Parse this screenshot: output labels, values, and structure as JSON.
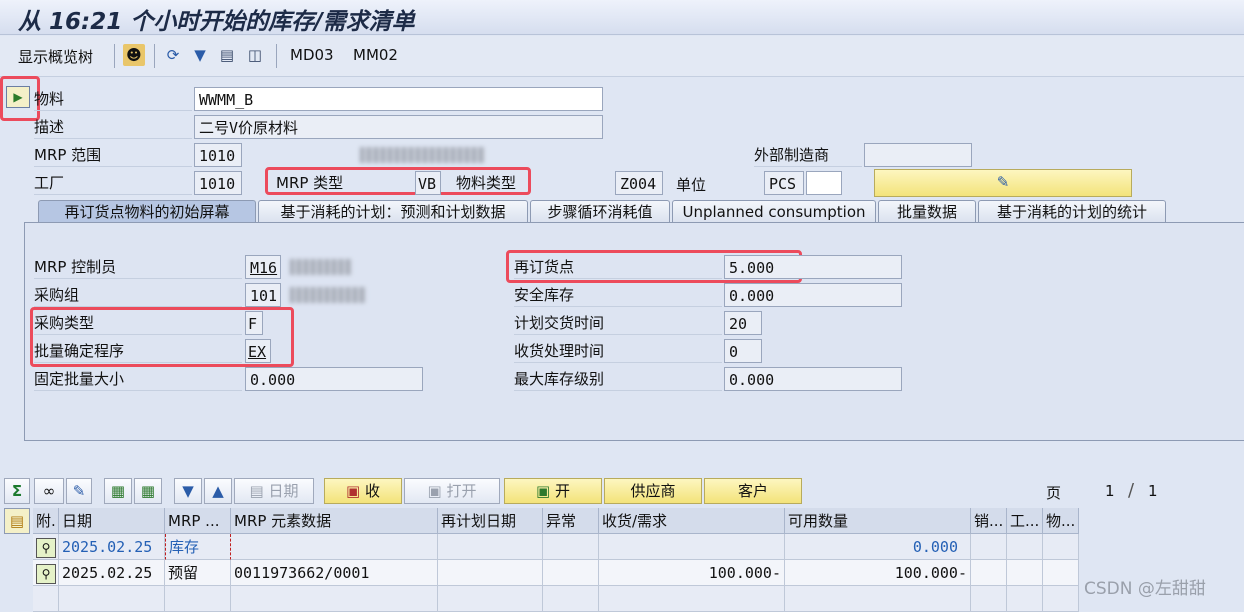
{
  "window": {
    "title": "从 16:21 个小时开始的库存/需求清单"
  },
  "app_toolbar": {
    "show_overview_tree": "显示概览树",
    "md03": "MD03",
    "mm02": "MM02"
  },
  "header": {
    "material_label": "物料",
    "material_value": "WWMM_B",
    "description_label": "描述",
    "description_value": "二号V价原材料",
    "mrp_area_label": "MRP 范围",
    "mrp_area_value": "1010",
    "ext_manufacturer_label": "外部制造商",
    "ext_manufacturer_value": "",
    "plant_label": "工厂",
    "plant_value": "1010",
    "mrp_type_label": "MRP 类型",
    "mrp_type_value": "VB",
    "material_type_label": "物料类型",
    "material_type_value": "Z004",
    "unit_label": "单位",
    "unit_value": "PCS"
  },
  "tabs": [
    "再订货点物料的初始屏幕",
    "基于消耗的计划：预测和计划数据",
    "步骤循环消耗值",
    "Unplanned consumption",
    "批量数据",
    "基于消耗的计划的统计"
  ],
  "tab_content": {
    "mrp_controller_label": "MRP 控制员",
    "mrp_controller_value": "M16",
    "purchasing_group_label": "采购组",
    "purchasing_group_value": "101",
    "procurement_type_label": "采购类型",
    "procurement_type_value": "F",
    "lot_size_label": "批量确定程序",
    "lot_size_value": "EX",
    "fixed_lot_label": "固定批量大小",
    "fixed_lot_value": "0.000",
    "reorder_point_label": "再订货点",
    "reorder_point_value": "5.000",
    "safety_stock_label": "安全库存",
    "safety_stock_value": "0.000",
    "planned_delivery_label": "计划交货时间",
    "planned_delivery_value": "20",
    "gr_processing_label": "收货处理时间",
    "gr_processing_value": "0",
    "max_stock_label": "最大库存级别",
    "max_stock_value": "0.000"
  },
  "grid_toolbar": {
    "date_button": "日期",
    "receive_button": "收",
    "open_button_disabled": "打开",
    "open_button": "开",
    "vendor_button": "供应商",
    "customer_button": "客户",
    "page_label": "页",
    "page_current": "1",
    "page_sep": "/",
    "page_total": "1"
  },
  "grid": {
    "columns": [
      "附.",
      "日期",
      "MRP ...",
      "MRP 元素数据",
      "再计划日期",
      "异常",
      "收货/需求",
      "可用数量",
      "销...",
      "工...",
      "物..."
    ],
    "rows": [
      {
        "date": "2025.02.25",
        "mrp": "库存",
        "element": "",
        "reschedule": "",
        "exception": "",
        "receipt": "",
        "available": "0.000"
      },
      {
        "date": "2025.02.25",
        "mrp": "预留",
        "element": "0011973662/0001",
        "reschedule": "",
        "exception": "",
        "receipt": "100.000-",
        "available": "100.000-"
      }
    ]
  },
  "watermark": "CSDN @左甜甜",
  "colors": {
    "highlight_red": "#ec4b5c",
    "button_yellow": "#f3e37a",
    "link_blue": "#2460b5"
  }
}
